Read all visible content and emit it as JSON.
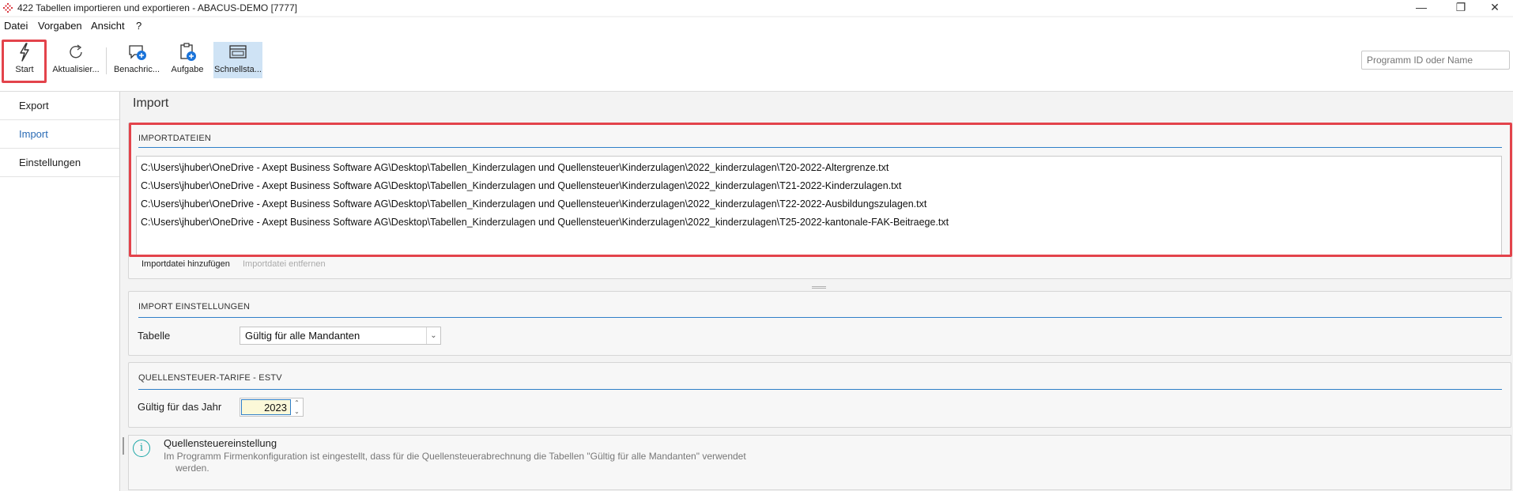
{
  "window": {
    "title": "422 Tabellen importieren und exportieren - ABACUS-DEMO [7777]",
    "minimize": "—",
    "restore": "❐",
    "close": "✕"
  },
  "menu": {
    "items": [
      "Datei",
      "Vorgaben",
      "Ansicht",
      "?"
    ]
  },
  "toolbar": {
    "buttons": [
      {
        "label": "Start",
        "icon": "lightning-icon"
      },
      {
        "label": "Aktualisier...",
        "icon": "refresh-icon"
      },
      {
        "label": "Benachric...",
        "icon": "notification-add-icon"
      },
      {
        "label": "Aufgabe",
        "icon": "clipboard-add-icon"
      },
      {
        "label": "Schnellsta...",
        "icon": "window-icon"
      }
    ],
    "search_placeholder": "Programm ID oder Name"
  },
  "sidebar": {
    "items": [
      "Export",
      "Import",
      "Einstellungen"
    ],
    "active": "Import"
  },
  "content": {
    "title": "Import"
  },
  "import_files": {
    "heading": "IMPORTDATEIEN",
    "files": [
      "C:\\Users\\jhuber\\OneDrive - Axept Business Software AG\\Desktop\\Tabellen_Kinderzulagen und Quellensteuer\\Kinderzulagen\\2022_kinderzulagen\\T20-2022-Altergrenze.txt",
      "C:\\Users\\jhuber\\OneDrive - Axept Business Software AG\\Desktop\\Tabellen_Kinderzulagen und Quellensteuer\\Kinderzulagen\\2022_kinderzulagen\\T21-2022-Kinderzulagen.txt",
      "C:\\Users\\jhuber\\OneDrive - Axept Business Software AG\\Desktop\\Tabellen_Kinderzulagen und Quellensteuer\\Kinderzulagen\\2022_kinderzulagen\\T22-2022-Ausbildungszulagen.txt",
      "C:\\Users\\jhuber\\OneDrive - Axept Business Software AG\\Desktop\\Tabellen_Kinderzulagen und Quellensteuer\\Kinderzulagen\\2022_kinderzulagen\\T25-2022-kantonale-FAK-Beitraege.txt"
    ],
    "add_label": "Importdatei hinzufügen",
    "remove_label": "Importdatei entfernen"
  },
  "import_settings": {
    "heading": "IMPORT EINSTELLUNGEN",
    "table_label": "Tabelle",
    "table_value": "Gültig für alle Mandanten"
  },
  "tariffs": {
    "heading": "QUELLENSTEUER-TARIFE - ESTV",
    "year_label": "Gültig für das Jahr",
    "year_value": "2023"
  },
  "info": {
    "title": "Quellensteuereinstellung",
    "text_line1": "Im Programm Firmenkonfiguration ist eingestellt, dass für die Quellensteuerabrechnung die Tabellen \"Gültig für alle Mandanten\" verwendet",
    "text_line2": "werden."
  },
  "colors": {
    "accent": "#2f7fc8",
    "highlight": "#e3434b",
    "active_button": "#cfe3f5",
    "info": "#1aa6a6"
  }
}
